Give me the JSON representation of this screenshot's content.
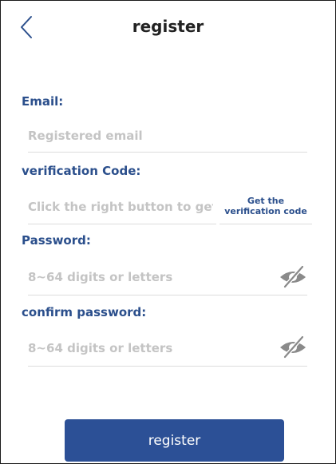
{
  "header": {
    "title": "register",
    "back_icon": "chevron-left-icon"
  },
  "form": {
    "email": {
      "label": "Email:",
      "placeholder": "Registered email",
      "value": ""
    },
    "verification": {
      "label": "verification Code:",
      "placeholder": "Click the right button to get",
      "value": "",
      "button_label": "Get the verification code"
    },
    "password": {
      "label": "Password:",
      "placeholder": "8~64 digits or letters",
      "value": "",
      "toggle_icon": "eye-slash-icon"
    },
    "confirm_password": {
      "label": "confirm password:",
      "placeholder": "8~64 digits or letters",
      "value": "",
      "toggle_icon": "eye-slash-icon"
    }
  },
  "footer": {
    "register_label": "register"
  },
  "colors": {
    "accent": "#2c5096",
    "label": "#2b4f8c",
    "placeholder": "#c4c4c4",
    "divider": "#dcdcdc"
  }
}
